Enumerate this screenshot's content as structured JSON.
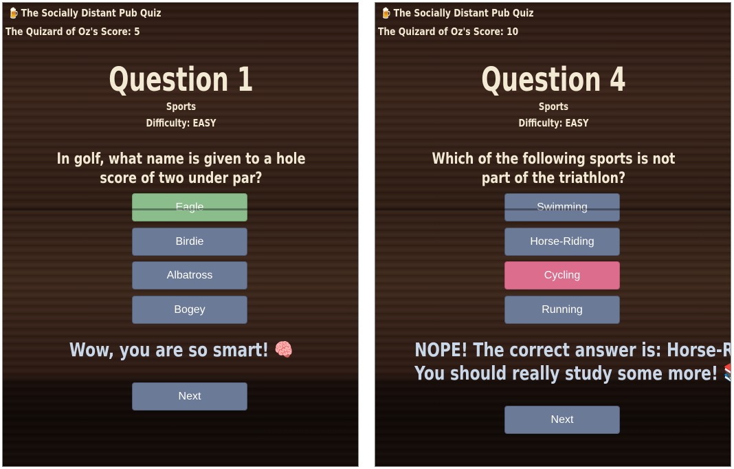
{
  "colors": {
    "button": "#6b7a96",
    "correct": "#8bbd8c",
    "wrong": "#dc6d8c",
    "feedback_text": "#c9d8e8",
    "heading_text": "#f3ead4"
  },
  "left": {
    "header": {
      "icon": "beer-mug-icon",
      "title": "The Socially Distant Pub Quiz",
      "score": "The Quizard of Oz's Score: 5"
    },
    "question": {
      "heading": "Question 1",
      "category": "Sports",
      "difficulty": "Difficulty: EASY",
      "text": "In golf, what name is given to a hole score of two under par?"
    },
    "answers": [
      "Eagle",
      "Birdie",
      "Albatross",
      "Bogey"
    ],
    "selected_state": "correct",
    "feedback": "Wow, you are so smart! 🧠",
    "feedback_icon": "brain-icon",
    "next_label": "Next"
  },
  "right": {
    "header": {
      "icon": "beer-mug-icon",
      "title": "The Socially Distant Pub Quiz",
      "score": "The Quizard of Oz's Score: 10"
    },
    "question": {
      "heading": "Question 4",
      "category": "Sports",
      "difficulty": "Difficulty: EASY",
      "text": "Which of the following sports is not part of the triathlon?"
    },
    "answers": [
      "Swimming",
      "Horse-Riding",
      "Cycling",
      "Running"
    ],
    "selected_state": "wrong",
    "feedback_line1": "NOPE! The correct answer is: Horse-Riding",
    "feedback_line2": "You should really study some more! 📚",
    "feedback_icon": "books-icon",
    "next_label": "Next"
  }
}
